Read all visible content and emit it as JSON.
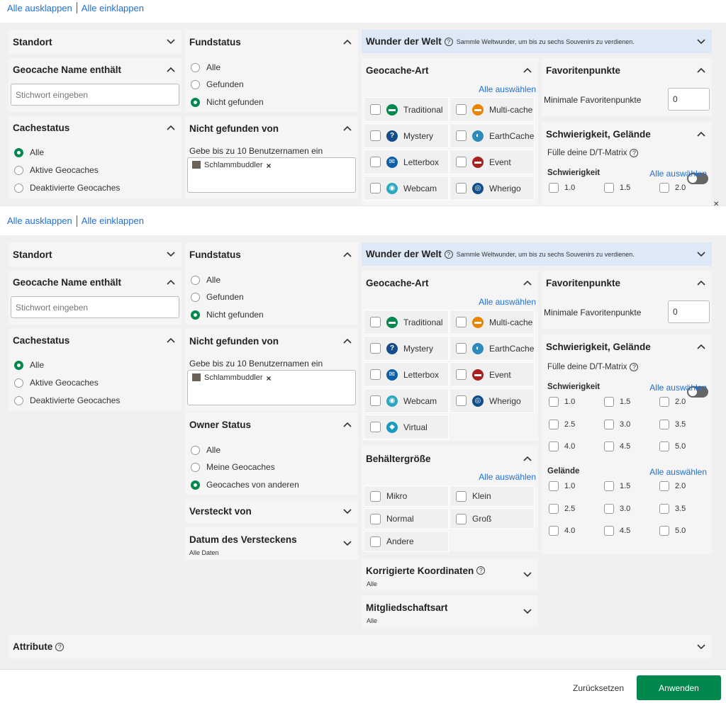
{
  "toolbar": {
    "expand_all": "Alle ausklappen",
    "collapse_all": "Alle einklappen"
  },
  "standort": {
    "title": "Standort"
  },
  "name_filter": {
    "title": "Geocache Name enthält",
    "placeholder": "Stichwort eingeben"
  },
  "cachestatus": {
    "title": "Cachestatus",
    "options": [
      "Alle",
      "Aktive Geocaches",
      "Deaktivierte Geocaches"
    ],
    "selected": "Alle"
  },
  "fundstatus": {
    "title": "Fundstatus",
    "options": [
      "Alle",
      "Gefunden",
      "Nicht gefunden"
    ],
    "selected": "Nicht gefunden"
  },
  "not_found_by": {
    "title": "Nicht gefunden von",
    "hint": "Gebe bis zu 10 Benutzernamen ein",
    "user_tag": "Schlammbuddler",
    "remove": "×"
  },
  "owner_status": {
    "title": "Owner Status",
    "options": [
      "Alle",
      "Meine Geocaches",
      "Geocaches von anderen"
    ],
    "selected": "Geocaches von anderen"
  },
  "hidden_by": {
    "title": "Versteckt von"
  },
  "hide_date": {
    "title": "Datum des Versteckens",
    "value": "Alle Daten"
  },
  "wonders": {
    "title": "Wunder der Welt",
    "desc": "Sammle Weltwunder, um bis zu sechs Souvenirs zu verdienen."
  },
  "geocache_type": {
    "title": "Geocache-Art",
    "select_all": "Alle auswählen",
    "types": [
      {
        "label": "Traditional",
        "icon": "traditional-icon",
        "color": "#02874d",
        "glyph": "▬"
      },
      {
        "label": "Multi-cache",
        "icon": "multi-cache-icon",
        "color": "#e98300",
        "glyph": "▬"
      },
      {
        "label": "Mystery",
        "icon": "mystery-icon",
        "color": "#154c8a",
        "glyph": "?"
      },
      {
        "label": "EarthCache",
        "icon": "earthcache-icon",
        "color": "#2e8ab8",
        "glyph": "◐"
      },
      {
        "label": "Letterbox",
        "icon": "letterbox-icon",
        "color": "#0d5ea8",
        "glyph": "✉"
      },
      {
        "label": "Event",
        "icon": "event-icon",
        "color": "#a82020",
        "glyph": "▬"
      },
      {
        "label": "Webcam",
        "icon": "webcam-icon",
        "color": "#2da6c2",
        "glyph": "◉"
      },
      {
        "label": "Wherigo",
        "icon": "wherigo-icon",
        "color": "#0d4f8b",
        "glyph": "◎"
      },
      {
        "label": "Virtual",
        "icon": "virtual-icon",
        "color": "#1a9bbf",
        "glyph": "◆"
      }
    ]
  },
  "container_size": {
    "title": "Behältergröße",
    "select_all": "Alle auswählen",
    "options": [
      "Mikro",
      "Klein",
      "Normal",
      "Groß",
      "Andere"
    ]
  },
  "corrected_coords": {
    "title": "Korrigierte Koordinaten",
    "value": "Alle"
  },
  "membership": {
    "title": "Mitgliedschaftsart",
    "value": "Alle"
  },
  "favorites": {
    "title": "Favoritenpunkte",
    "min_label": "Minimale Favoritenpunkte",
    "min_value": "0"
  },
  "dt": {
    "title": "Schwierigkeit, Gelände",
    "matrix_label": "Fülle deine D/T-Matrix",
    "difficulty_label": "Schwierigkeit",
    "terrain_label": "Gelände",
    "select_all": "Alle auswählen",
    "values": [
      "1.0",
      "1.5",
      "2.0",
      "2.5",
      "3.0",
      "3.5",
      "4.0",
      "4.5",
      "5.0"
    ]
  },
  "attributes": {
    "title": "Attribute"
  },
  "footer": {
    "reset": "Zurücksetzen",
    "apply": "Anwenden"
  },
  "colors": {
    "accent": "#02874d",
    "link": "#1f6fd1",
    "wonders_bg": "#dde9f7"
  }
}
